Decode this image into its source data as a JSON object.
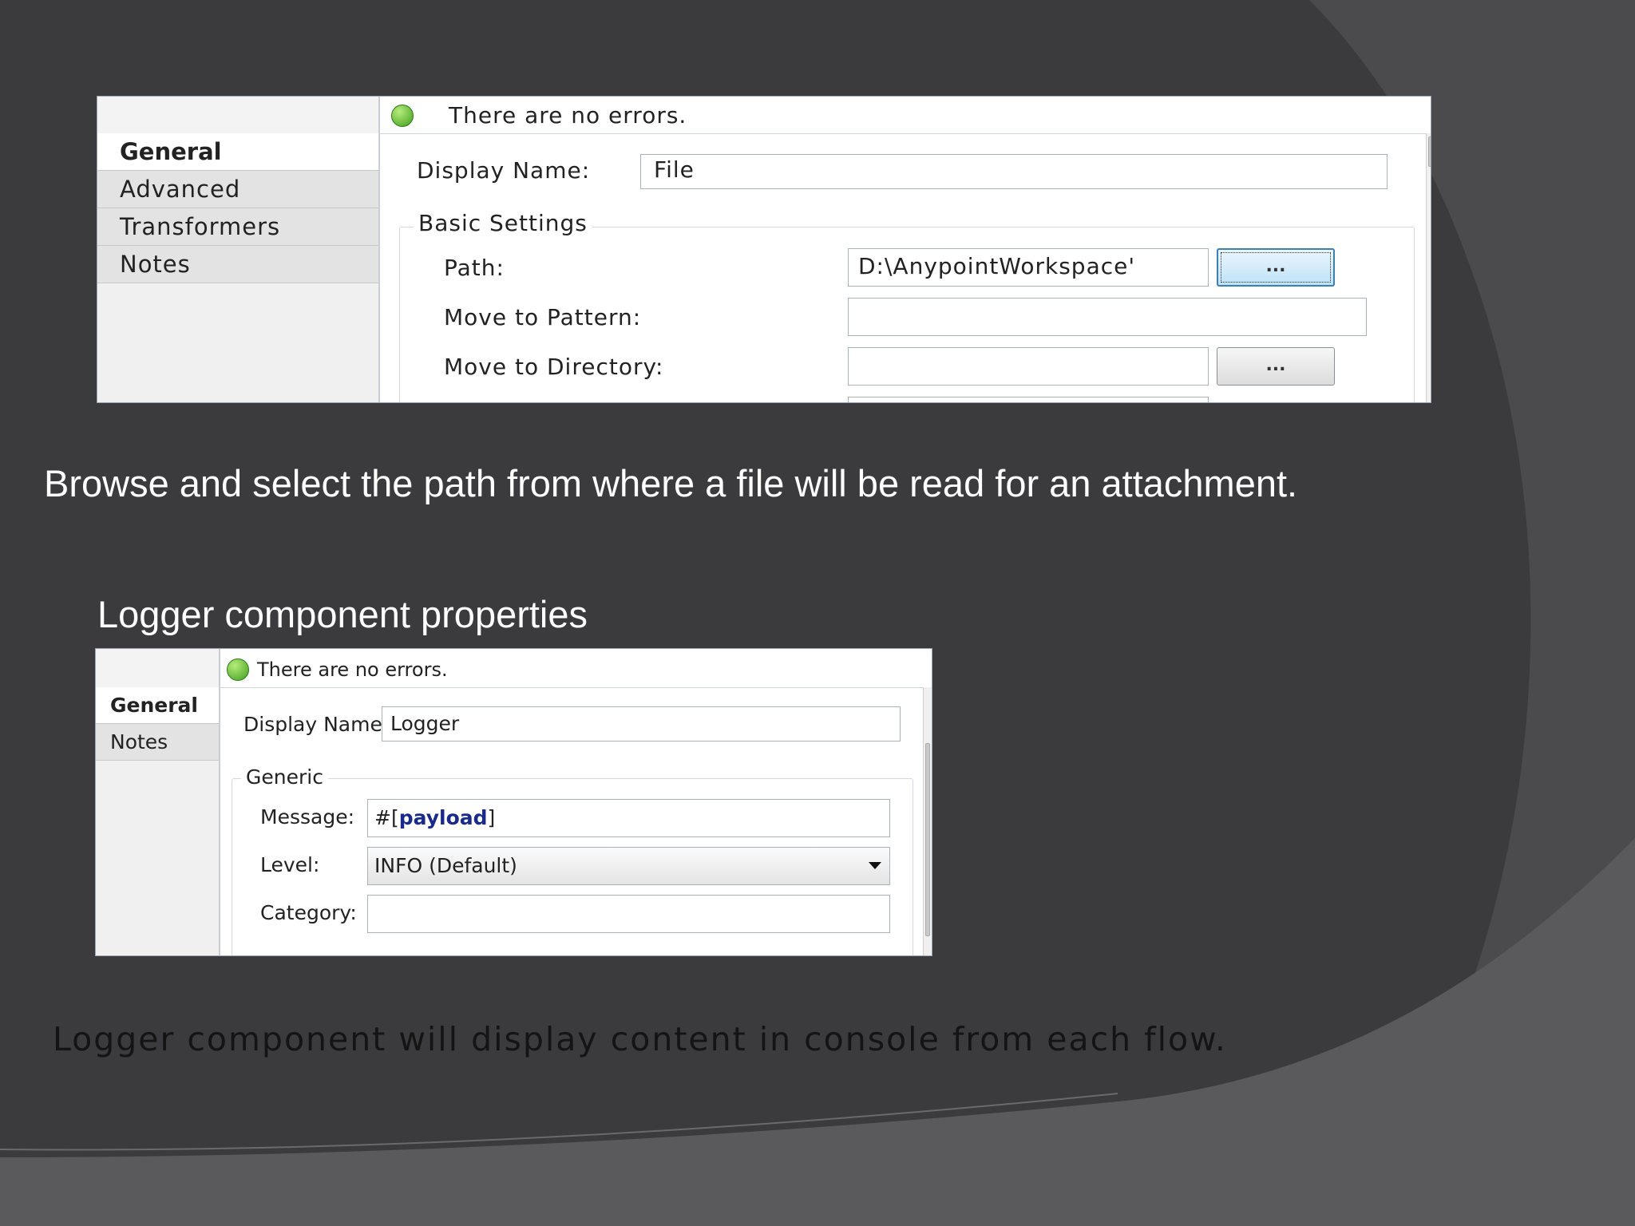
{
  "panel_file": {
    "status": "There are no errors.",
    "tabs": [
      "General",
      "Advanced",
      "Transformers",
      "Notes"
    ],
    "display_name_label": "Display Name:",
    "display_name_value": "File",
    "group_title": "Basic Settings",
    "path_label": "Path:",
    "path_value": "D:\\AnypointWorkspace'",
    "browse_label": "...",
    "move_pattern_label": "Move to Pattern:",
    "move_pattern_value": "",
    "move_dir_label": "Move to Directory:",
    "move_dir_value": ""
  },
  "caption_1": "Browse and select the path from where a file will be read for an attachment.",
  "caption_2": "Logger component properties",
  "panel_logger": {
    "status": "There are no errors.",
    "tabs": [
      "General",
      "Notes"
    ],
    "display_name_label": "Display Name:",
    "display_name_value": "Logger",
    "group_title": "Generic",
    "message_label": "Message:",
    "message_prefix": "#[",
    "message_keyword": "payload",
    "message_suffix": "]",
    "level_label": "Level:",
    "level_value": "INFO (Default)",
    "category_label": "Category:",
    "category_value": ""
  },
  "bottom_note": "Logger component will display content in console from each flow.",
  "colors": {
    "background": "#3b3a3d",
    "status_green": "#3f9f1e",
    "keyword_blue": "#1a2a8a"
  }
}
